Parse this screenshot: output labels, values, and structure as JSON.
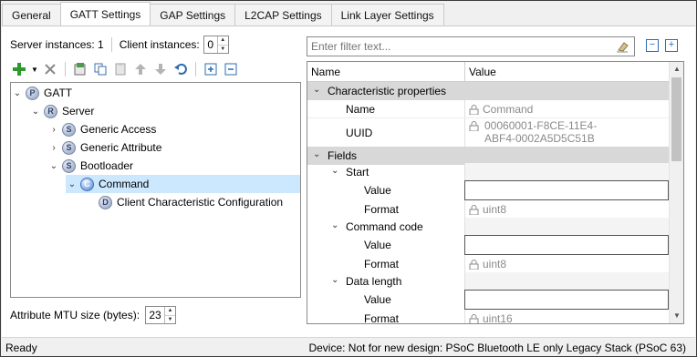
{
  "tabs": [
    "General",
    "GATT Settings",
    "GAP Settings",
    "L2CAP Settings",
    "Link Layer Settings"
  ],
  "active_tab": "GATT Settings",
  "instances": {
    "server_label": "Server instances: 1",
    "client_label": "Client instances:",
    "client_value": "0"
  },
  "tree": {
    "gatt": {
      "icon": "P",
      "label": "GATT"
    },
    "server": {
      "icon": "R",
      "label": "Server"
    },
    "generic_access": {
      "icon": "S",
      "label": "Generic Access"
    },
    "generic_attribute": {
      "icon": "S",
      "label": "Generic Attribute"
    },
    "bootloader": {
      "icon": "S",
      "label": "Bootloader"
    },
    "command": {
      "icon": "C",
      "label": "Command"
    },
    "cccd": {
      "icon": "D",
      "label": "Client Characteristic Configuration"
    }
  },
  "mtu": {
    "label": "Attribute MTU size (bytes):",
    "value": "23"
  },
  "filter": {
    "placeholder": "Enter filter text..."
  },
  "grid": {
    "col_name": "Name",
    "col_value": "Value",
    "char_props": "Characteristic properties",
    "name_key": "Name",
    "name_value": "Command",
    "uuid_key": "UUID",
    "uuid_line1": "00060001-F8CE-11E4-",
    "uuid_line2": "ABF4-0002A5D5C51B",
    "fields": "Fields",
    "start": "Start",
    "start_value_key": "Value",
    "start_format_key": "Format",
    "start_format_value": "uint8",
    "command_code": "Command code",
    "cc_value_key": "Value",
    "cc_format_key": "Format",
    "cc_format_value": "uint8",
    "data_length": "Data length",
    "dl_value_key": "Value",
    "dl_format_key": "Format",
    "dl_format_value": "uint16"
  },
  "status": {
    "left": "Ready",
    "right": "Device: Not for new design: PSoC Bluetooth LE only Legacy Stack (PSoC 63)"
  }
}
